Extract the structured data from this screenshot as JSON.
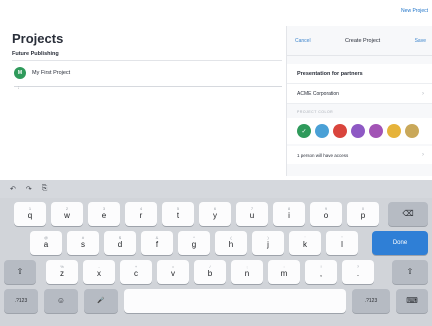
{
  "topbar": {
    "new_project": "New Project"
  },
  "page": {
    "title": "Projects",
    "workspace": "Future Publishing"
  },
  "projects": [
    {
      "name": "My First Project",
      "avatar": "M"
    }
  ],
  "modal": {
    "cancel": "Cancel",
    "title": "Create Project",
    "save": "Save",
    "project_name": "Presentation for partners",
    "organization": "ACME Corporation",
    "color_label": "PROJECT COLOR",
    "colors": [
      "#2f9a5b",
      "#4aa0d6",
      "#d9453d",
      "#8e59c4",
      "#a253b5",
      "#e6b33a",
      "#c9a85a"
    ],
    "access": "1 person will have access"
  },
  "shortcuts": {
    "undo": "↶",
    "redo": "↷",
    "paste": "⎘"
  },
  "keyboard": {
    "row1": [
      {
        "hint": "1",
        "main": "q"
      },
      {
        "hint": "2",
        "main": "w"
      },
      {
        "hint": "3",
        "main": "e"
      },
      {
        "hint": "4",
        "main": "r"
      },
      {
        "hint": "5",
        "main": "t"
      },
      {
        "hint": "6",
        "main": "y"
      },
      {
        "hint": "7",
        "main": "u"
      },
      {
        "hint": "8",
        "main": "i"
      },
      {
        "hint": "9",
        "main": "o"
      },
      {
        "hint": "0",
        "main": "p"
      }
    ],
    "row2": [
      {
        "hint": "@",
        "main": "a"
      },
      {
        "hint": "#",
        "main": "s"
      },
      {
        "hint": "$",
        "main": "d"
      },
      {
        "hint": "&",
        "main": "f"
      },
      {
        "hint": "*",
        "main": "g"
      },
      {
        "hint": "(",
        "main": "h"
      },
      {
        "hint": ")",
        "main": "j"
      },
      {
        "hint": "'",
        "main": "k"
      },
      {
        "hint": "\"",
        "main": "l"
      }
    ],
    "row3": [
      {
        "hint": "%",
        "main": "z"
      },
      {
        "hint": "-",
        "main": "x"
      },
      {
        "hint": "+",
        "main": "c"
      },
      {
        "hint": "=",
        "main": "v"
      },
      {
        "hint": "/",
        "main": "b"
      },
      {
        "hint": ";",
        "main": "n"
      },
      {
        "hint": ":",
        "main": "m"
      },
      {
        "hint": "!",
        "main": ","
      },
      {
        "hint": "?",
        "main": "."
      }
    ],
    "backspace": "⌫",
    "done": "Done",
    "shift": "⇧",
    "numbers": ".?123",
    "globe": "☺",
    "mic": "🎤",
    "numbers_right": ".?123",
    "hide": "⌨"
  }
}
